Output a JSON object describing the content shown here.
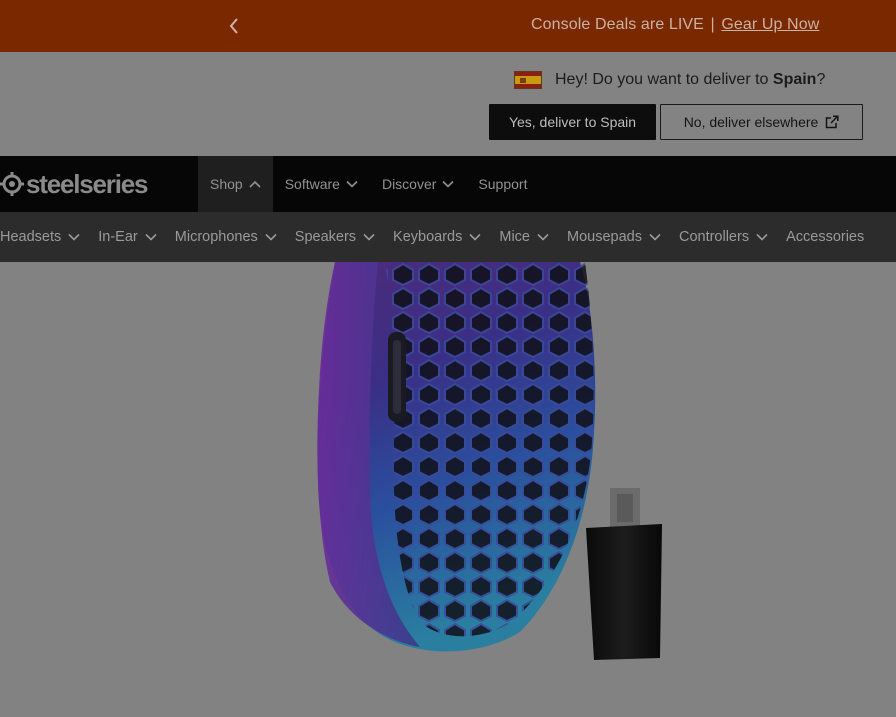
{
  "promo": {
    "text": "Console Deals are LIVE",
    "separator": "|",
    "link": "Gear Up Now"
  },
  "deliver": {
    "question_prefix": "Hey! Do you want to deliver to ",
    "country": "Spain",
    "question_suffix": "?",
    "yes_label": "Yes, deliver to Spain",
    "no_label": "No, deliver elsewhere"
  },
  "brand": {
    "name": "steelseries"
  },
  "nav": {
    "items": [
      {
        "label": "Shop",
        "state": "expanded"
      },
      {
        "label": "Software"
      },
      {
        "label": "Discover"
      },
      {
        "label": "Support"
      }
    ]
  },
  "categories": {
    "items": [
      {
        "label": "Headsets"
      },
      {
        "label": "In-Ear"
      },
      {
        "label": "Microphones"
      },
      {
        "label": "Speakers"
      },
      {
        "label": "Keyboards"
      },
      {
        "label": "Mice"
      },
      {
        "label": "Mousepads"
      },
      {
        "label": "Controllers"
      },
      {
        "label": "Accessories"
      }
    ]
  },
  "colors": {
    "promo_bg": "#7a2800",
    "nav_bg": "#060606",
    "catnav_bg": "#2c2c2c",
    "overlay_bg": "#838383"
  }
}
